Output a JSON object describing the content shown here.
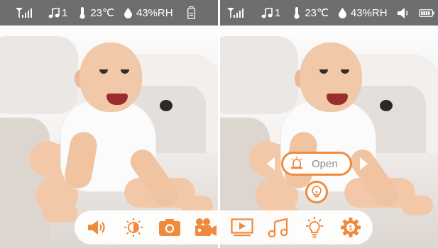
{
  "colors": {
    "accent": "#f08a3c",
    "statusbar": "#6e6e6e",
    "popup_text": "#8a8a8a"
  },
  "left_status": {
    "signal_icon": "signal-strength-icon",
    "music_count": "1",
    "temperature": "23℃",
    "humidity": "43%RH",
    "battery_icon": "camera-battery-icon"
  },
  "right_status": {
    "signal_icon": "signal-strength-icon",
    "music_count": "1",
    "temperature": "23℃",
    "humidity": "43%RH",
    "speaker_icon": "speaker-icon",
    "battery_icon": "battery-full-icon"
  },
  "alarm_popup": {
    "label": "Open",
    "icon": "alarm-bell-icon"
  },
  "light_button": {
    "icon": "night-light-icon"
  },
  "toolbar": {
    "items": [
      {
        "name": "volume",
        "icon": "speaker-volume-icon"
      },
      {
        "name": "brightness",
        "icon": "brightness-icon"
      },
      {
        "name": "snapshot",
        "icon": "camera-icon"
      },
      {
        "name": "record",
        "icon": "video-record-icon"
      },
      {
        "name": "playback",
        "icon": "playback-icon"
      },
      {
        "name": "lullaby",
        "icon": "music-note-icon"
      },
      {
        "name": "night-light",
        "icon": "light-bulb-icon"
      },
      {
        "name": "settings",
        "icon": "gear-icon",
        "badge": "1"
      }
    ]
  }
}
